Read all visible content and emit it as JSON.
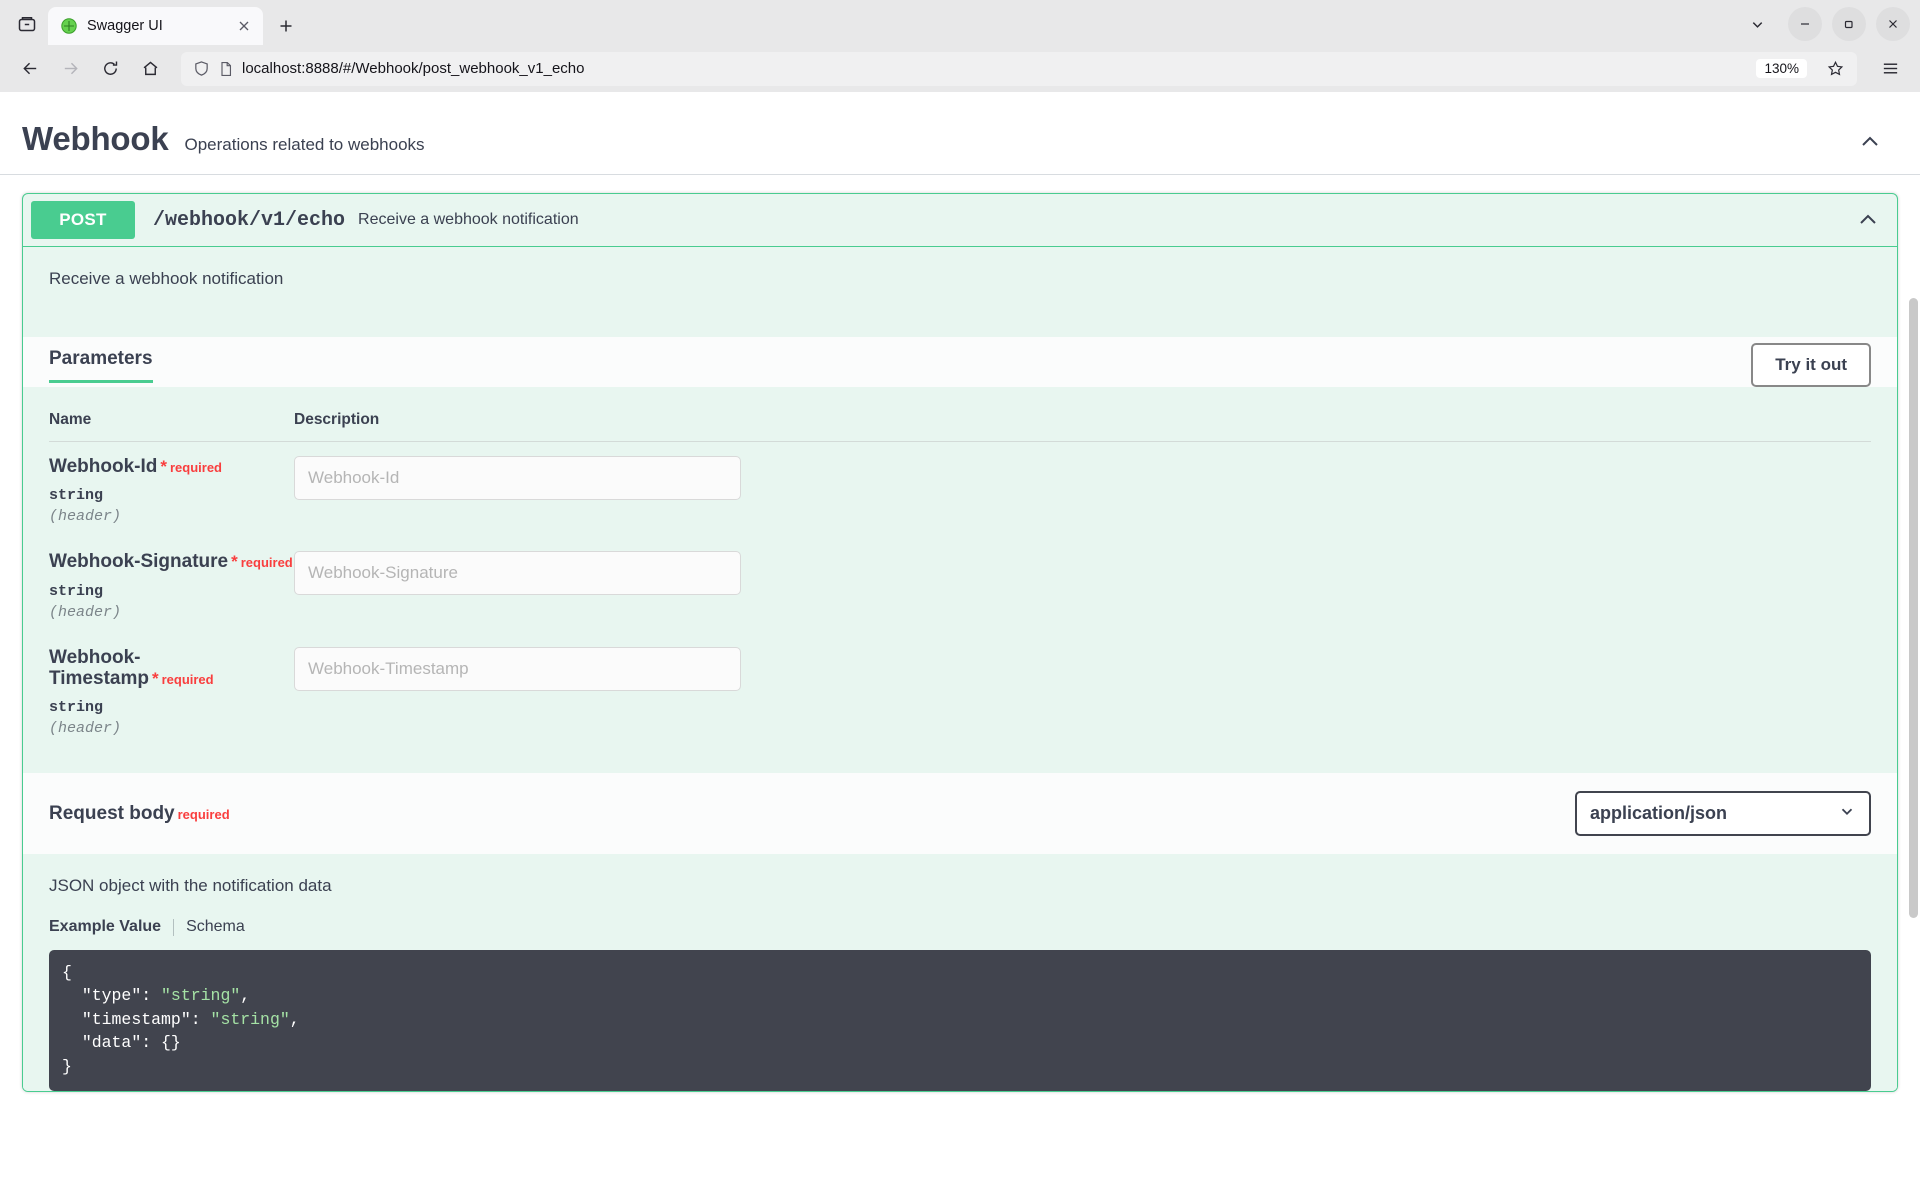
{
  "browser": {
    "tab": {
      "title": "Swagger UI",
      "favicon_icon": "swagger-logo-icon",
      "close_icon": "close-icon"
    },
    "new_tab_icon": "plus-icon",
    "list_all_tabs_icon": "chevron-down-icon",
    "firefox_view_icon": "firefox-view-icon",
    "window_controls": {
      "minimize_icon": "minimize-icon",
      "maximize_icon": "maximize-icon",
      "close_icon": "window-close-icon"
    },
    "nav": {
      "back_icon": "back-arrow-icon",
      "forward_icon": "forward-arrow-icon",
      "reload_icon": "reload-icon",
      "home_icon": "home-icon",
      "menu_icon": "hamburger-menu-icon"
    },
    "urlbar": {
      "shield_icon": "shield-icon",
      "page_icon": "page-document-icon",
      "url": "localhost:8888/#/Webhook/post_webhook_v1_echo",
      "zoom_level": "130%",
      "bookmark_icon": "star-icon"
    }
  },
  "tag": {
    "title": "Webhook",
    "description": "Operations related to webhooks",
    "collapse_icon": "chevron-up-icon"
  },
  "operation": {
    "method": "POST",
    "path": "/webhook/v1/echo",
    "summary": "Receive a webhook notification",
    "description": "Receive a webhook notification",
    "collapse_icon": "chevron-up-icon",
    "method_color": "#49cc90"
  },
  "parameters_section": {
    "title": "Parameters",
    "try_it_out_label": "Try it out",
    "columns": {
      "name": "Name",
      "description": "Description"
    },
    "rows": [
      {
        "name": "Webhook-Id",
        "required_star": "*",
        "required_label": "required",
        "type": "string",
        "location": "(header)",
        "input_placeholder": "Webhook-Id",
        "input_value": ""
      },
      {
        "name": "Webhook-Signature",
        "required_star": "*",
        "required_label": "required",
        "type": "string",
        "location": "(header)",
        "input_placeholder": "Webhook-Signature",
        "input_value": ""
      },
      {
        "name": "Webhook-Timestamp",
        "required_star": "*",
        "required_label": "required",
        "type": "string",
        "location": "(header)",
        "input_placeholder": "Webhook-Timestamp",
        "input_value": ""
      }
    ]
  },
  "request_body": {
    "title": "Request body",
    "required_label": "required",
    "media_type_selected": "application/json",
    "media_type_options": [
      "application/json"
    ],
    "dropdown_icon": "chevron-down-icon",
    "description": "JSON object with the notification data",
    "tabs": {
      "example_value": "Example Value",
      "schema": "Schema"
    },
    "example_lines": [
      {
        "indent": 0,
        "parts": [
          {
            "t": "{",
            "c": "key"
          }
        ]
      },
      {
        "indent": 1,
        "parts": [
          {
            "t": "\"type\": ",
            "c": "key"
          },
          {
            "t": "\"string\"",
            "c": "str"
          },
          {
            "t": ",",
            "c": "key"
          }
        ]
      },
      {
        "indent": 1,
        "parts": [
          {
            "t": "\"timestamp\": ",
            "c": "key"
          },
          {
            "t": "\"string\"",
            "c": "str"
          },
          {
            "t": ",",
            "c": "key"
          }
        ]
      },
      {
        "indent": 1,
        "parts": [
          {
            "t": "\"data\": {}",
            "c": "key"
          }
        ]
      },
      {
        "indent": 0,
        "parts": [
          {
            "t": "}",
            "c": "key"
          }
        ]
      }
    ]
  },
  "colors": {
    "post_green": "#49cc90",
    "opblock_bg": "#e8f6f0",
    "required_red": "#f93e3e",
    "text_dark": "#3b4151",
    "code_bg": "#41444e",
    "code_string": "#a5e2a5"
  }
}
